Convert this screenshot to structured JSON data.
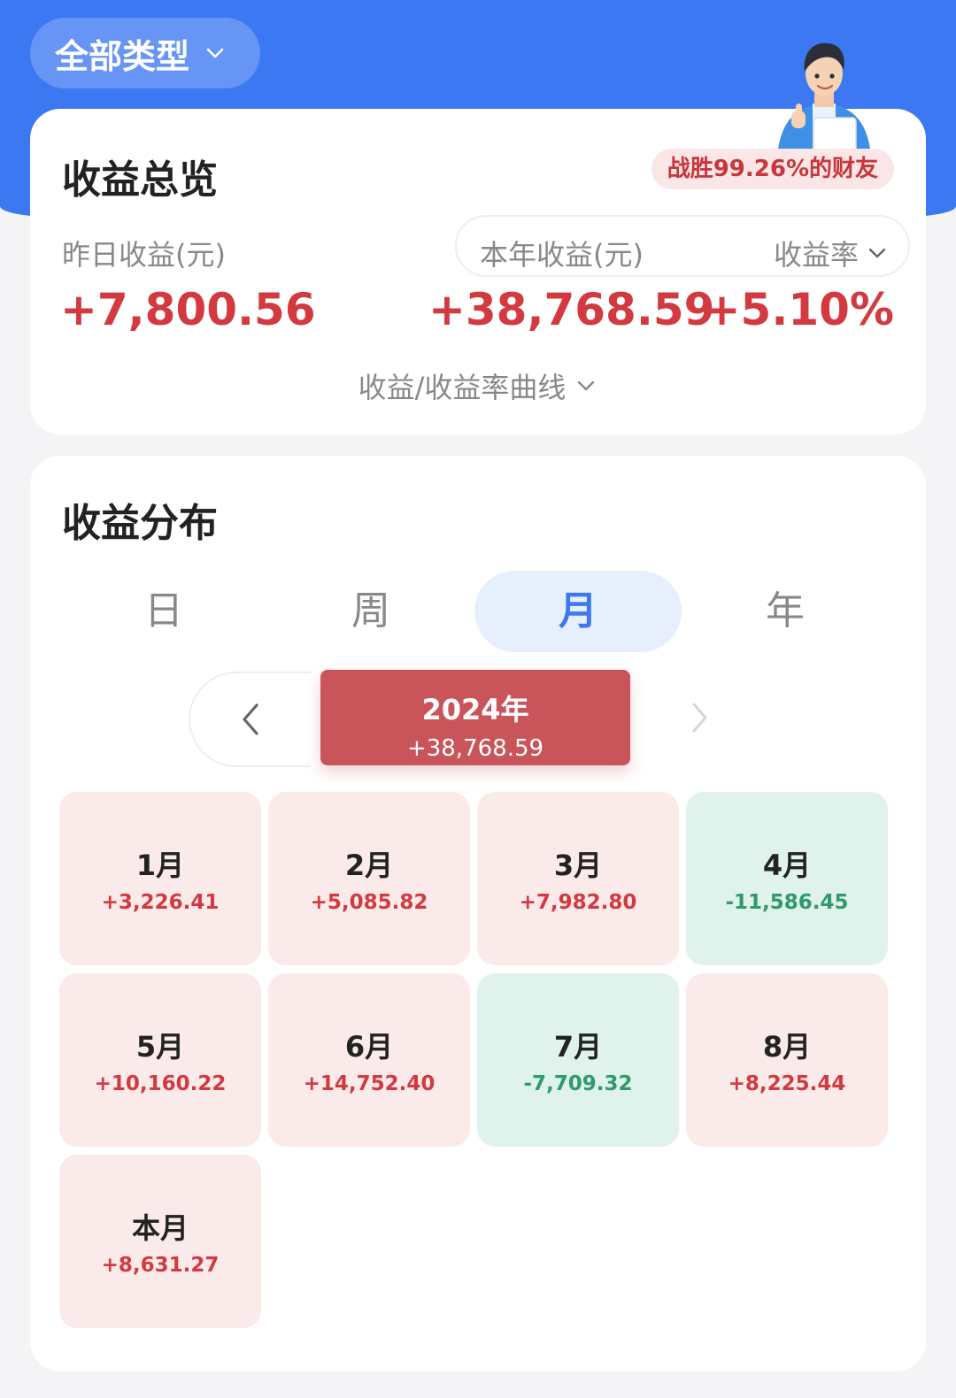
{
  "header": {
    "type_filter_label": "全部类型"
  },
  "overview": {
    "title": "收益总览",
    "beat_badge": "战胜99.26%的财友",
    "yesterday_label": "昨日收益(元)",
    "yesterday_value": "+7,800.56",
    "year_label": "本年收益(元)",
    "year_value": "+38,768.59",
    "rate_label": "收益率",
    "rate_value": "+5.10%",
    "curve_toggle": "收益/收益率曲线"
  },
  "distribution": {
    "title": "收益分布",
    "tabs": [
      {
        "label": "日",
        "active": false
      },
      {
        "label": "周",
        "active": false
      },
      {
        "label": "月",
        "active": true
      },
      {
        "label": "年",
        "active": false
      }
    ],
    "year_selector": {
      "label": "2024年",
      "value": "+38,768.59"
    },
    "months": [
      {
        "label": "1月",
        "value": "+3,226.41",
        "trend": "pos"
      },
      {
        "label": "2月",
        "value": "+5,085.82",
        "trend": "pos"
      },
      {
        "label": "3月",
        "value": "+7,982.80",
        "trend": "pos"
      },
      {
        "label": "4月",
        "value": "-11,586.45",
        "trend": "neg"
      },
      {
        "label": "5月",
        "value": "+10,160.22",
        "trend": "pos"
      },
      {
        "label": "6月",
        "value": "+14,752.40",
        "trend": "pos"
      },
      {
        "label": "7月",
        "value": "-7,709.32",
        "trend": "neg"
      },
      {
        "label": "8月",
        "value": "+8,225.44",
        "trend": "pos"
      },
      {
        "label": "本月",
        "value": "+8,631.27",
        "trend": "pos"
      }
    ]
  },
  "colors": {
    "brand_blue": "#3b78f2",
    "gain_red": "#d23a3f",
    "loss_green": "#2f9a6b",
    "selected_year_bg": "#c9545a"
  },
  "icons": {
    "filter_chevron": "chevron-down-icon",
    "prev": "chevron-left-icon",
    "next": "chevron-right-icon",
    "mascot": "mascot-thumbs-up-illustration"
  }
}
